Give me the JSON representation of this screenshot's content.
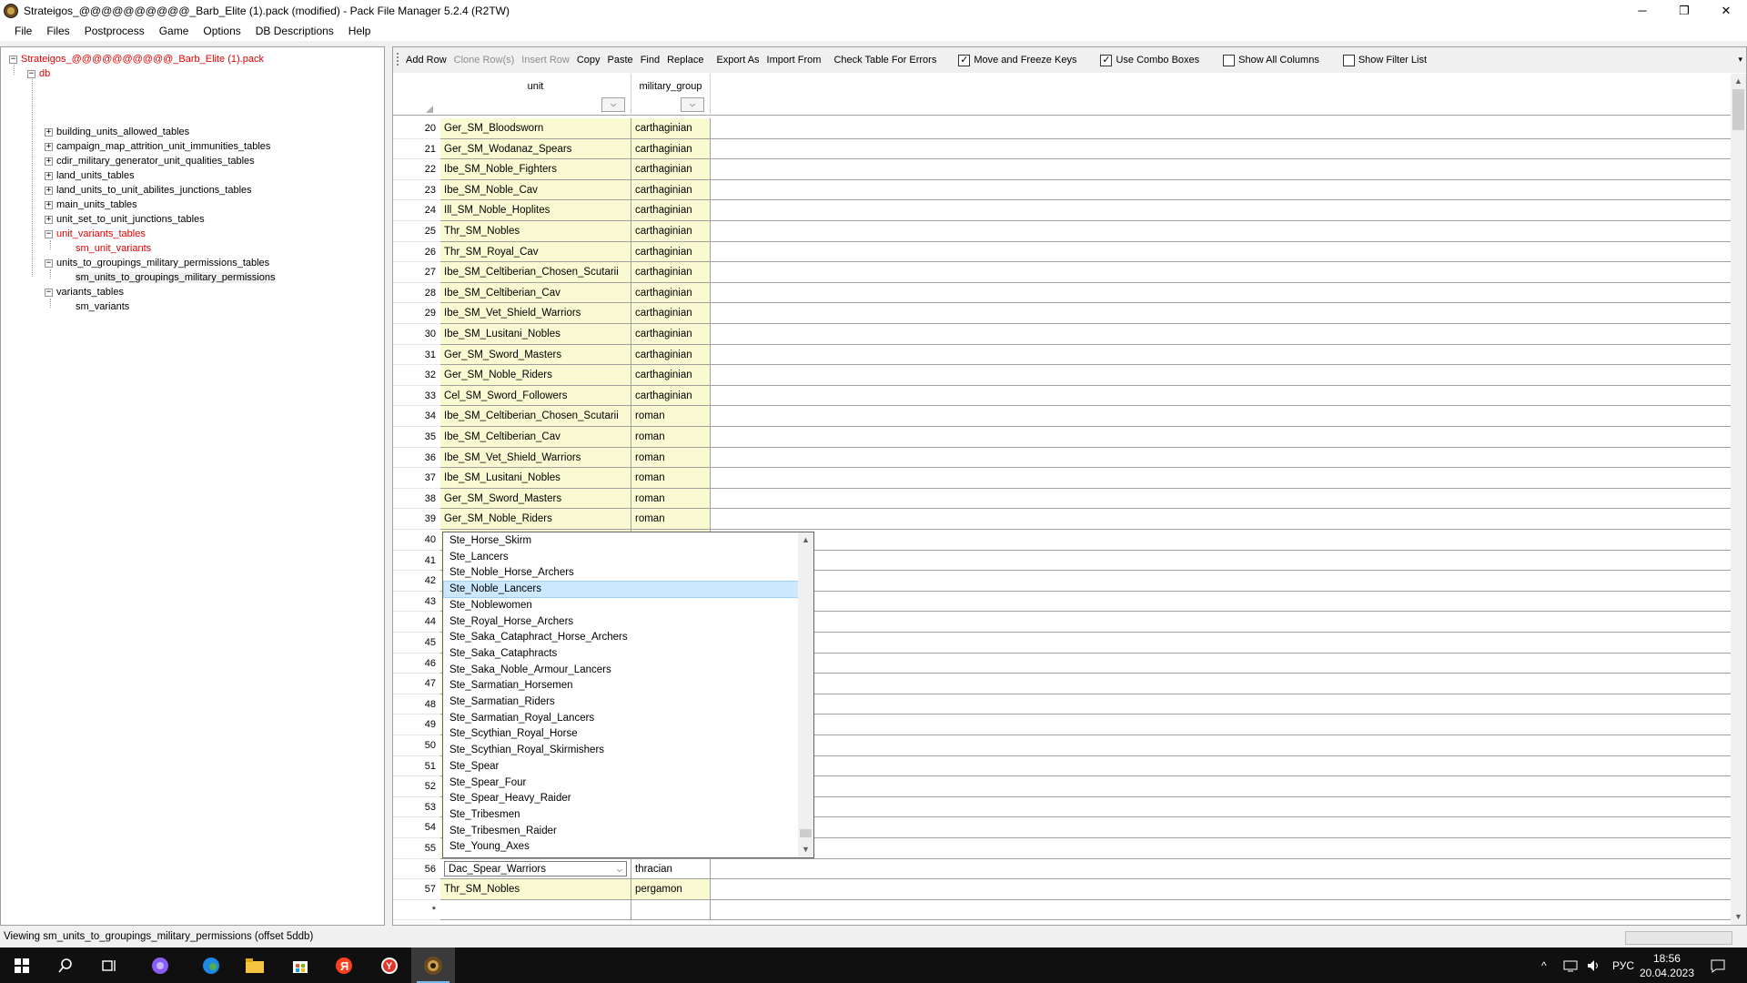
{
  "window": {
    "title": "Strateigos_@@@@@@@@@@_Barb_Elite (1).pack (modified) - Pack File Manager 5.2.4 (R2TW)",
    "controls": {
      "minimize": "─",
      "maximize": "❐",
      "close": "✕"
    }
  },
  "menu": [
    "File",
    "Files",
    "Postprocess",
    "Game",
    "Options",
    "DB Descriptions",
    "Help"
  ],
  "tree": {
    "root": "Strateigos_@@@@@@@@@@_Barb_Elite (1).pack",
    "db": "db",
    "tables": [
      "building_units_allowed_tables",
      "campaign_map_attrition_unit_immunities_tables",
      "cdir_military_generator_unit_qualities_tables",
      "land_units_tables",
      "land_units_to_unit_abilites_junctions_tables",
      "main_units_tables",
      "unit_set_to_unit_junctions_tables",
      "unit_variants_tables",
      "sm_unit_variants",
      "units_to_groupings_military_permissions_tables",
      "sm_units_to_groupings_military_permissions",
      "variants_tables",
      "sm_variants"
    ]
  },
  "toolbar": {
    "buttons": [
      "Add Row",
      "Clone Row(s)",
      "Insert Row",
      "Copy",
      "Paste",
      "Find",
      "Replace",
      "Export As",
      "Import From",
      "Check Table For Errors"
    ],
    "checkboxes": [
      {
        "label": "Move and Freeze Keys",
        "checked": true
      },
      {
        "label": "Use Combo Boxes",
        "checked": true
      },
      {
        "label": "Show All Columns",
        "checked": false
      },
      {
        "label": "Show Filter List",
        "checked": false
      }
    ],
    "check_mark": "✓",
    "overflow": "▾"
  },
  "grid": {
    "columns": [
      "unit",
      "military_group"
    ],
    "combo_arrow": "⌵",
    "rows": [
      {
        "num": "20",
        "unit": "Ger_SM_Bloodsworn",
        "group": "carthaginian"
      },
      {
        "num": "21",
        "unit": "Ger_SM_Wodanaz_Spears",
        "group": "carthaginian"
      },
      {
        "num": "22",
        "unit": "Ibe_SM_Noble_Fighters",
        "group": "carthaginian"
      },
      {
        "num": "23",
        "unit": "Ibe_SM_Noble_Cav",
        "group": "carthaginian"
      },
      {
        "num": "24",
        "unit": "Ill_SM_Noble_Hoplites",
        "group": "carthaginian"
      },
      {
        "num": "25",
        "unit": "Thr_SM_Nobles",
        "group": "carthaginian"
      },
      {
        "num": "26",
        "unit": "Thr_SM_Royal_Cav",
        "group": "carthaginian"
      },
      {
        "num": "27",
        "unit": "Ibe_SM_Celtiberian_Chosen_Scutarii",
        "group": "carthaginian"
      },
      {
        "num": "28",
        "unit": "Ibe_SM_Celtiberian_Cav",
        "group": "carthaginian"
      },
      {
        "num": "29",
        "unit": "Ibe_SM_Vet_Shield_Warriors",
        "group": "carthaginian"
      },
      {
        "num": "30",
        "unit": "Ibe_SM_Lusitani_Nobles",
        "group": "carthaginian"
      },
      {
        "num": "31",
        "unit": "Ger_SM_Sword_Masters",
        "group": "carthaginian"
      },
      {
        "num": "32",
        "unit": "Ger_SM_Noble_Riders",
        "group": "carthaginian"
      },
      {
        "num": "33",
        "unit": "Cel_SM_Sword_Followers",
        "group": "carthaginian"
      },
      {
        "num": "34",
        "unit": "Ibe_SM_Celtiberian_Chosen_Scutarii",
        "group": "roman"
      },
      {
        "num": "35",
        "unit": "Ibe_SM_Celtiberian_Cav",
        "group": "roman"
      },
      {
        "num": "36",
        "unit": "Ibe_SM_Vet_Shield_Warriors",
        "group": "roman"
      },
      {
        "num": "37",
        "unit": "Ibe_SM_Lusitani_Nobles",
        "group": "roman"
      },
      {
        "num": "38",
        "unit": "Ger_SM_Sword_Masters",
        "group": "roman"
      },
      {
        "num": "39",
        "unit": "Ger_SM_Noble_Riders",
        "group": "roman"
      },
      {
        "num": "40",
        "unit": "",
        "group": ""
      },
      {
        "num": "41",
        "unit": "",
        "group": ""
      },
      {
        "num": "42",
        "unit": "",
        "group": ""
      },
      {
        "num": "43",
        "unit": "",
        "group": ""
      },
      {
        "num": "44",
        "unit": "",
        "group": ""
      },
      {
        "num": "45",
        "unit": "",
        "group": ""
      },
      {
        "num": "46",
        "unit": "",
        "group": ""
      },
      {
        "num": "47",
        "unit": "",
        "group": ""
      },
      {
        "num": "48",
        "unit": "",
        "group": ""
      },
      {
        "num": "49",
        "unit": "",
        "group": ""
      },
      {
        "num": "50",
        "unit": "",
        "group": ""
      },
      {
        "num": "51",
        "unit": "",
        "group": ""
      },
      {
        "num": "52",
        "unit": "",
        "group": ""
      },
      {
        "num": "53",
        "unit": "",
        "group": ""
      },
      {
        "num": "54",
        "unit": "",
        "group": ""
      },
      {
        "num": "55",
        "unit": "",
        "group": ""
      }
    ],
    "edit_row": {
      "num": "56",
      "unit": "Dac_Spear_Warriors",
      "group": "thracian"
    },
    "last_row": {
      "num": "57",
      "unit": "Thr_SM_Nobles",
      "group": "pergamon"
    },
    "new_row_marker": "*"
  },
  "dropdown": {
    "items": [
      "Ste_Horse_Skirm",
      "Ste_Lancers",
      "Ste_Noble_Horse_Archers",
      "Ste_Noble_Lancers",
      "Ste_Noblewomen",
      "Ste_Royal_Horse_Archers",
      "Ste_Saka_Cataphract_Horse_Archers",
      "Ste_Saka_Cataphracts",
      "Ste_Saka_Noble_Armour_Lancers",
      "Ste_Sarmatian_Horsemen",
      "Ste_Sarmatian_Riders",
      "Ste_Sarmatian_Royal_Lancers",
      "Ste_Scythian_Royal_Horse",
      "Ste_Scythian_Royal_Skirmishers",
      "Ste_Spear",
      "Ste_Spear_Four",
      "Ste_Spear_Heavy_Raider",
      "Ste_Tribesmen",
      "Ste_Tribesmen_Raider",
      "Ste_Young_Axes"
    ],
    "selected": "Ste_Noble_Lancers",
    "up_arrow": "▲",
    "down_arrow": "▼"
  },
  "status": {
    "text": "Viewing sm_units_to_groupings_military_permissions (offset 5ddb)"
  },
  "taskbar": {
    "language": "РУС",
    "time": "18:56",
    "date": "20.04.2023"
  },
  "colors": {
    "key_cell": "#fafad2",
    "tree_highlight": "#e00000",
    "dropdown_selected": "#cce8ff",
    "taskbar": "#101010"
  }
}
